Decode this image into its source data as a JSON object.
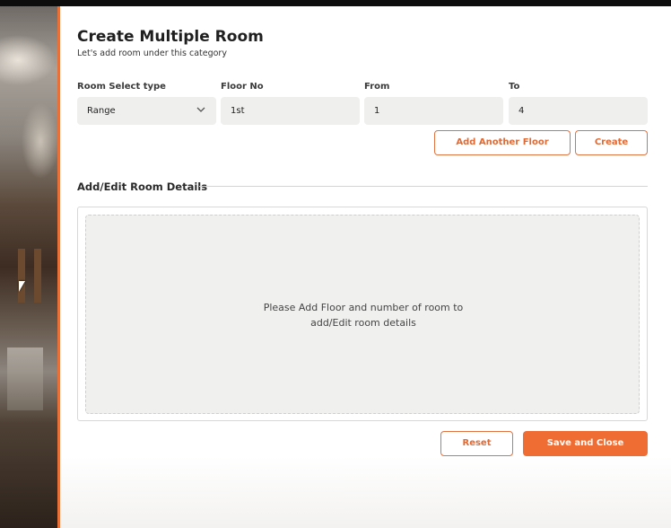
{
  "dialog": {
    "title": "Create Multiple Room",
    "subtitle": "Let's add room under this category"
  },
  "form": {
    "room_select_type": {
      "label": "Room Select type",
      "value": "Range"
    },
    "floor_no": {
      "label": "Floor No",
      "value": "1st"
    },
    "from": {
      "label": "From",
      "value": "1"
    },
    "to": {
      "label": "To",
      "value": "4"
    }
  },
  "actions": {
    "add_another_floor": "Add Another Floor",
    "create": "Create"
  },
  "details": {
    "title": "Add/Edit Room Details",
    "empty_line1": "Please Add Floor and number of room to",
    "empty_line2": "add/Edit room details"
  },
  "footer": {
    "reset": "Reset",
    "save_and_close": "Save and Close"
  },
  "colors": {
    "accent": "#ef6c33",
    "field_bg": "#efefee"
  },
  "icons": {
    "dropdown": "chevron-down-icon",
    "cursor": "mouse-pointer-icon"
  }
}
